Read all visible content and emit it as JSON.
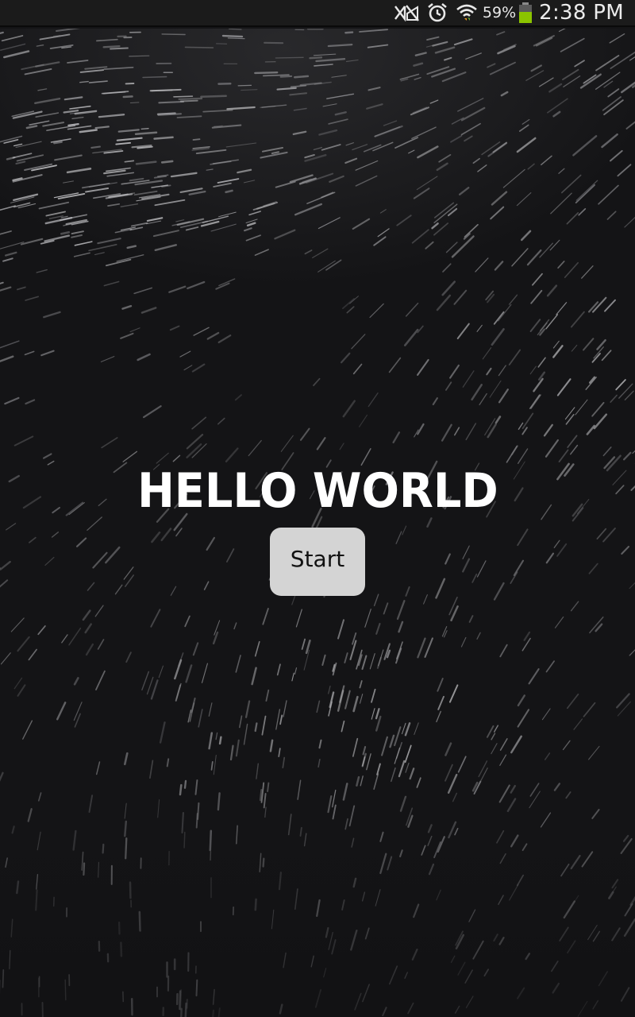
{
  "status_bar": {
    "battery_percent": "59%",
    "battery_level": 0.59,
    "time": "2:38 PM",
    "icons": [
      "no-signal-icon",
      "alarm-icon",
      "wifi-icon",
      "battery-icon"
    ],
    "battery_color": "#8bc400"
  },
  "main": {
    "title": "HELLO WORLD",
    "start_label": "Start"
  },
  "theme": {
    "background": "#141416",
    "button_background": "#d4d4d4",
    "title_color": "#ffffff"
  }
}
